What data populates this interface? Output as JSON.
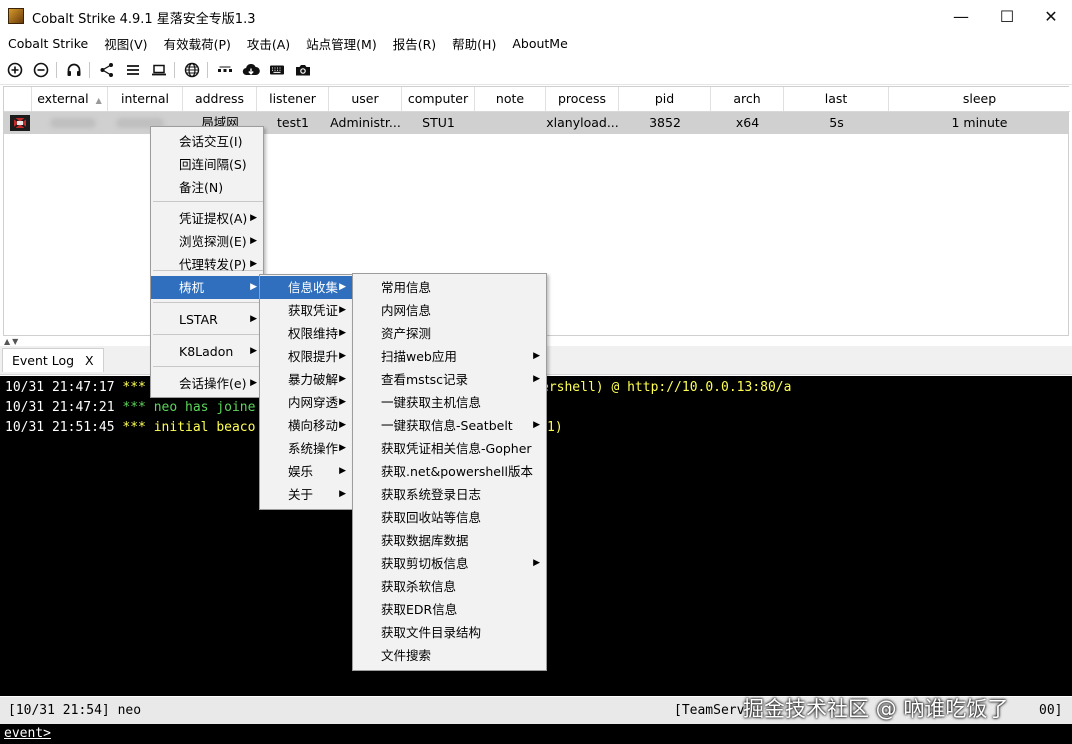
{
  "window": {
    "title": "Cobalt Strike 4.9.1 星落安全专版1.3"
  },
  "menubar": [
    "Cobalt Strike",
    "视图(V)",
    "有效载荷(P)",
    "攻击(A)",
    "站点管理(M)",
    "报告(R)",
    "帮助(H)",
    "AboutMe"
  ],
  "toolbar_icons": [
    "add-icon",
    "remove-icon",
    "headphones-icon",
    "share-icon",
    "list-icon",
    "laptop-icon",
    "globe-icon",
    "dots-icon",
    "cloud-download-icon",
    "keyboard-icon",
    "camera-icon"
  ],
  "table": {
    "columns": [
      "external",
      "internal",
      "address",
      "listener",
      "user",
      "computer",
      "note",
      "process",
      "pid",
      "arch",
      "last",
      "sleep"
    ],
    "sort_indicator": "▲",
    "rows": [
      {
        "external": "",
        "internal": "",
        "address": "局域网",
        "listener": "test1",
        "user": "Administr...",
        "computer": "STU1",
        "note": "",
        "process": "xlanyload...",
        "pid": "3852",
        "arch": "x64",
        "last": "5s",
        "sleep": "1 minute"
      }
    ]
  },
  "tabs": [
    {
      "label": "Event Log",
      "close": "X"
    }
  ],
  "console": {
    "lines": [
      {
        "time": "10/31 21:47:17",
        "stars": "***",
        "text": "",
        "tail": "ershell) @ http://10.0.0.13:80/a"
      },
      {
        "time": "10/31 21:47:21",
        "stars": "***",
        "text": "neo has joine",
        "tail": ""
      },
      {
        "time": "10/31 21:51:45",
        "stars": "***",
        "text": "initial beaco",
        "tail": "1)"
      }
    ],
    "status_left": "[10/31 21:54] neo",
    "status_right_prefix": "[TeamServ",
    "status_right_suffix": "00]",
    "prompt": "event>"
  },
  "watermark": "掘金技术社区 @ 吶谁吃饭了",
  "context_menu": {
    "items": [
      "会话交互(I)",
      "回连间隔(S)",
      "备注(N)",
      "凭证提权(A)",
      "浏览探测(E)",
      "代理转发(P)",
      "梼杌",
      "LSTAR",
      "K8Ladon",
      "会话操作(e)"
    ],
    "selected": "梼杌"
  },
  "submenu_1": {
    "items": [
      "信息收集",
      "获取凭证",
      "权限维持",
      "权限提升",
      "暴力破解",
      "内网穿透",
      "横向移动",
      "系统操作",
      "娱乐",
      "关于"
    ],
    "selected": "信息收集"
  },
  "submenu_2": {
    "items": [
      "常用信息",
      "内网信息",
      "资产探测",
      "扫描web应用",
      "查看mstsc记录",
      "一键获取主机信息",
      "一键获取信息-Seatbelt",
      "获取凭证相关信息-Gopher",
      "获取.net&powershell版本",
      "获取系统登录日志",
      "获取回收站等信息",
      "获取数据库数据",
      "获取剪切板信息",
      "获取杀软信息",
      "获取EDR信息",
      "获取文件目录结构",
      "文件搜索"
    ],
    "with_submenu": [
      "扫描web应用",
      "查看mstsc记录",
      "一键获取信息-Seatbelt",
      "获取剪切板信息"
    ]
  },
  "colors": {
    "selection": "#2f6fbd",
    "console_bg": "#000000",
    "console_yellow": "#ffff54",
    "console_green": "#5bd55b",
    "row_highlight": "#d0d0d0"
  }
}
